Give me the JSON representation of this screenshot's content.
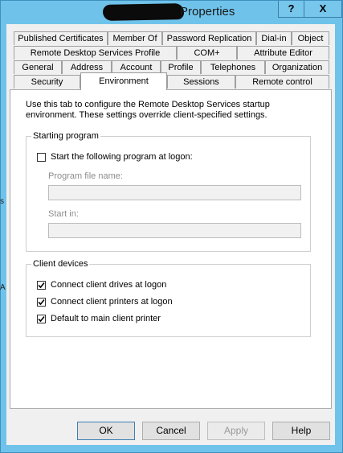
{
  "window": {
    "title_visible": "Properties",
    "help_glyph": "?",
    "close_glyph": "X"
  },
  "tabs": {
    "row1": [
      "Published Certificates",
      "Member Of",
      "Password Replication",
      "Dial-in",
      "Object"
    ],
    "row2": [
      "Remote Desktop Services Profile",
      "COM+",
      "Attribute Editor"
    ],
    "row3": [
      "General",
      "Address",
      "Account",
      "Profile",
      "Telephones",
      "Organization"
    ],
    "row4": [
      "Security",
      "Environment",
      "Sessions",
      "Remote control"
    ],
    "selected": "Environment"
  },
  "environment": {
    "intro": "Use this tab to configure the Remote Desktop Services startup environment. These settings override client-specified settings.",
    "starting_program": {
      "group_label": "Starting program",
      "start_checkbox_label": "Start the following program at logon:",
      "start_checkbox_checked": false,
      "program_file_label": "Program file name:",
      "program_file_value": "",
      "start_in_label": "Start in:",
      "start_in_value": ""
    },
    "client_devices": {
      "group_label": "Client devices",
      "items": [
        {
          "label": "Connect client drives at logon",
          "checked": true
        },
        {
          "label": "Connect client printers at logon",
          "checked": true
        },
        {
          "label": "Default to main client printer",
          "checked": true
        }
      ]
    }
  },
  "buttons": {
    "ok": "OK",
    "cancel": "Cancel",
    "apply": "Apply",
    "help": "Help"
  }
}
